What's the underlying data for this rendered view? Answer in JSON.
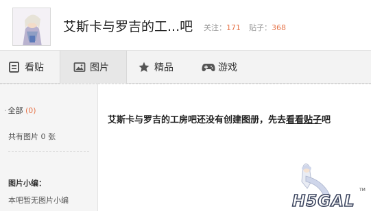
{
  "header": {
    "title": "艾斯卡与罗吉的工...吧",
    "follow_label": "关注：",
    "follow_count": "171",
    "posts_label": "贴子：",
    "posts_count": "368"
  },
  "tabs": [
    {
      "label": "看贴",
      "icon": "document-icon"
    },
    {
      "label": "图片",
      "icon": "image-icon"
    },
    {
      "label": "精品",
      "icon": "star-icon"
    },
    {
      "label": "游戏",
      "icon": "gamepad-icon"
    }
  ],
  "sidebar": {
    "all_label": "全部",
    "all_count": "(0)",
    "total_text": "共有图片 0 张",
    "editor_title": "图片小编：",
    "editor_note": "本吧暂无图片小编"
  },
  "main": {
    "message_prefix": "艾斯卡与罗吉的工房吧还没有创建图册，先去",
    "message_link": "看看贴子",
    "message_suffix": "吧"
  },
  "watermark": {
    "text": "H5GAL",
    "tm": "TM"
  },
  "colors": {
    "accent": "#e6764c",
    "tab_bg": "#f3f3f3",
    "sidebar_bg": "#f5f5f5"
  }
}
